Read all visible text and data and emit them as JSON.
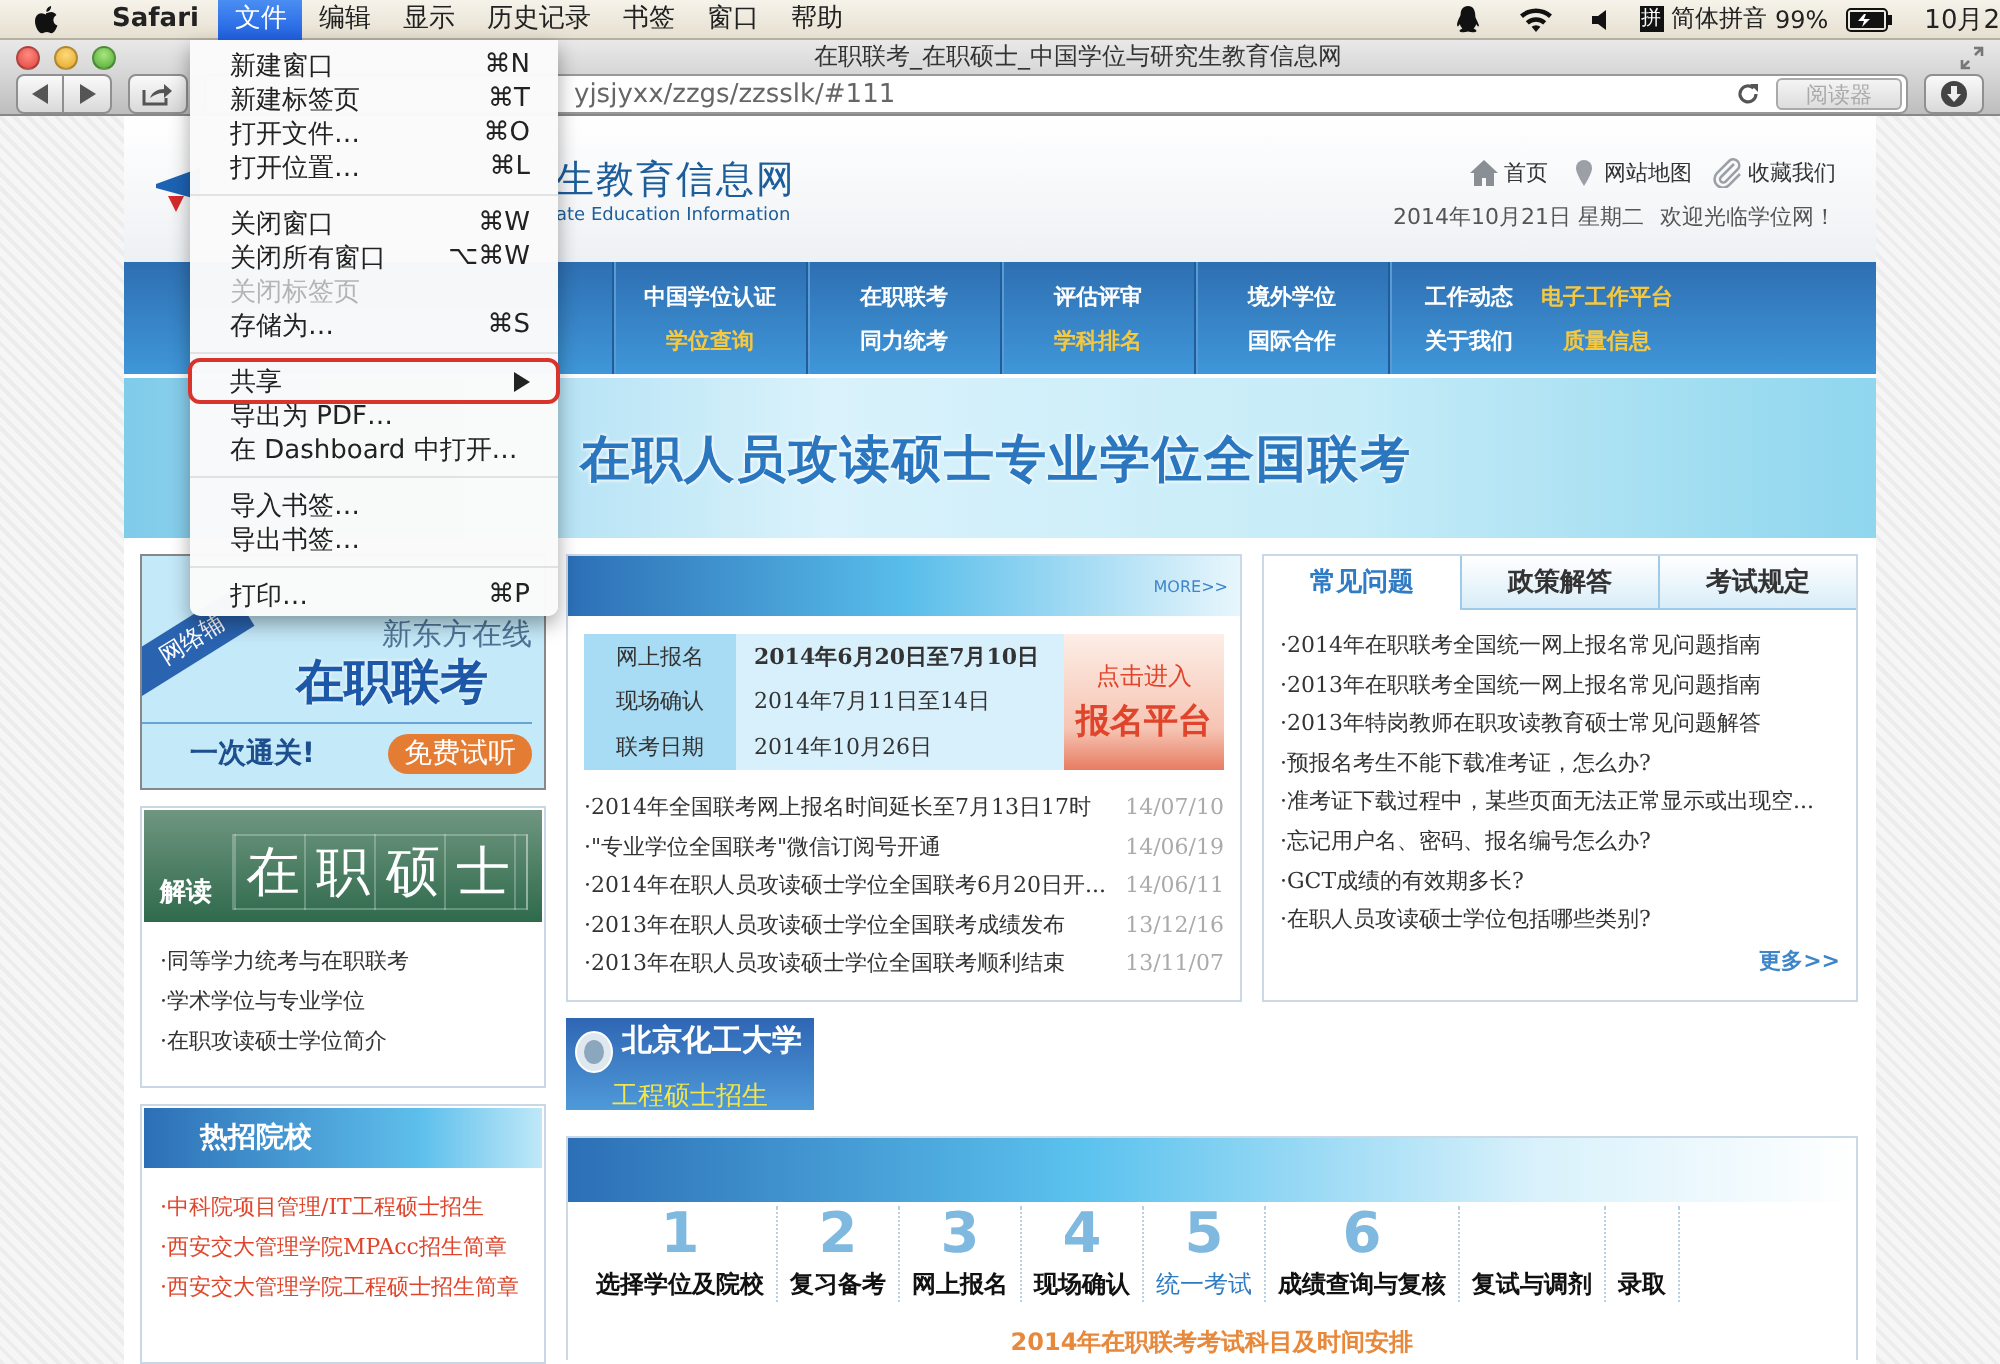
{
  "menubar": {
    "items": [
      {
        "label": "Safari",
        "kind": "app",
        "selected": false
      },
      {
        "label": "文件",
        "kind": "menu",
        "selected": true
      },
      {
        "label": "编辑",
        "kind": "menu",
        "selected": false
      },
      {
        "label": "显示",
        "kind": "menu",
        "selected": false
      },
      {
        "label": "历史记录",
        "kind": "menu",
        "selected": false
      },
      {
        "label": "书签",
        "kind": "menu",
        "selected": false
      },
      {
        "label": "窗口",
        "kind": "menu",
        "selected": false
      },
      {
        "label": "帮助",
        "kind": "menu",
        "selected": false
      }
    ],
    "input_icon": "拼",
    "input_method": "简体拼音",
    "battery": "99%",
    "clock": "10月2"
  },
  "file_menu": {
    "items": [
      {
        "kind": "item",
        "label": "新建窗口",
        "shortcut": "⌘N",
        "disabled": false,
        "submenu": false,
        "marked": false
      },
      {
        "kind": "item",
        "label": "新建标签页",
        "shortcut": "⌘T",
        "disabled": false,
        "submenu": false,
        "marked": false
      },
      {
        "kind": "item",
        "label": "打开文件…",
        "shortcut": "⌘O",
        "disabled": false,
        "submenu": false,
        "marked": false
      },
      {
        "kind": "item",
        "label": "打开位置…",
        "shortcut": "⌘L",
        "disabled": false,
        "submenu": false,
        "marked": false
      },
      {
        "kind": "separator"
      },
      {
        "kind": "item",
        "label": "关闭窗口",
        "shortcut": "⌘W",
        "disabled": false,
        "submenu": false,
        "marked": false
      },
      {
        "kind": "item",
        "label": "关闭所有窗口",
        "shortcut": "⌥⌘W",
        "disabled": false,
        "submenu": false,
        "marked": false
      },
      {
        "kind": "item",
        "label": "关闭标签页",
        "disabled": true,
        "submenu": false,
        "marked": false
      },
      {
        "kind": "item",
        "label": "存储为…",
        "shortcut": "⌘S",
        "disabled": false,
        "submenu": false,
        "marked": false
      },
      {
        "kind": "separator"
      },
      {
        "kind": "item",
        "label": "共享",
        "disabled": false,
        "submenu": true,
        "marked": true
      },
      {
        "kind": "item",
        "label": "导出为 PDF…",
        "disabled": false,
        "submenu": false,
        "marked": false
      },
      {
        "kind": "item",
        "label": "在 Dashboard 中打开…",
        "disabled": false,
        "submenu": false,
        "marked": false
      },
      {
        "kind": "separator"
      },
      {
        "kind": "item",
        "label": "导入书签…",
        "disabled": false,
        "submenu": false,
        "marked": false
      },
      {
        "kind": "item",
        "label": "导出书签…",
        "disabled": false,
        "submenu": false,
        "marked": false
      },
      {
        "kind": "separator"
      },
      {
        "kind": "item",
        "label": "打印…",
        "shortcut": "⌘P",
        "disabled": false,
        "submenu": false,
        "marked": false
      }
    ]
  },
  "window": {
    "title": "在职联考_在职硕士_中国学位与研究生教育信息网",
    "address": "yjsjyxx/zzgs/zzsslk/#111",
    "reader_button": {
      "label": "阅读器",
      "disabled": true
    }
  },
  "site": {
    "logo": {
      "title": "生教育信息网",
      "subtitle": "ate Education Information"
    },
    "top_links": [
      {
        "label": "首页",
        "kind": "home"
      },
      {
        "label": "网站地图",
        "kind": "pin"
      },
      {
        "label": "收藏我们",
        "kind": "clip"
      }
    ],
    "date": "2014年10月21日 星期二",
    "welcome": "欢迎光临学位网！",
    "nav": [
      {
        "links": [
          {
            "label": "中国学位认证",
            "highlight": false
          },
          {
            "label": "学位查询",
            "highlight": true
          }
        ]
      },
      {
        "links": [
          {
            "label": "在职联考",
            "highlight": false
          },
          {
            "label": "同力统考",
            "highlight": false
          }
        ]
      },
      {
        "links": [
          {
            "label": "评估评审",
            "highlight": false
          },
          {
            "label": "学科排名",
            "highlight": true
          }
        ]
      },
      {
        "links": [
          {
            "label": "境外学位",
            "highlight": false
          },
          {
            "label": "国际合作",
            "highlight": false
          }
        ]
      },
      {
        "links": [
          {
            "label": "工作动态",
            "highlight": false
          },
          {
            "label": "关于我们",
            "highlight": false
          },
          {
            "label": "电子工作平台",
            "highlight": true
          },
          {
            "label": "质量信息",
            "highlight": true
          }
        ]
      }
    ],
    "banner": {
      "title": "在职人员攻读硕士专业学位全国联考"
    },
    "left_ad": {
      "ribbon": "网络辅",
      "brand": "新东方在线",
      "title": "在职联考",
      "slogan": "一次通关!",
      "button": "免费试听"
    },
    "interpret": {
      "prefix": "解读",
      "title": "在职硕士",
      "links": [
        "·同等学力统考与在职联考",
        "·学术学位与专业学位",
        "·在职攻读硕士学位简介"
      ]
    },
    "hot_schools": {
      "title": "热招院校",
      "links": [
        "·中科院项目管理/IT工程硕士招生",
        "·西安交大管理学院MPAcc招生简章",
        "·西安交大管理学院工程硕士招生简章"
      ]
    },
    "exam": {
      "more": "MORE>>",
      "schedule": [
        {
          "label": "网上报名",
          "value": "2014年6月20日至7月10日",
          "bold": true
        },
        {
          "label": "现场确认",
          "value": "2014年7月11日至14日",
          "bold": false
        },
        {
          "label": "联考日期",
          "value": "2014年10月26日",
          "bold": false
        }
      ],
      "enter_button": {
        "line1": "点击进入",
        "line2": "报名平台"
      },
      "news": [
        {
          "title": "·2014年全国联考网上报名时间延长至7月13日17时",
          "date": "14/07/10"
        },
        {
          "title": "·\"专业学位全国联考\"微信订阅号开通",
          "date": "14/06/19"
        },
        {
          "title": "·2014年在职人员攻读硕士学位全国联考6月20日开...",
          "date": "14/06/11"
        },
        {
          "title": "·2013年在职人员攻读硕士学位全国联考成绩发布",
          "date": "13/12/16"
        },
        {
          "title": "·2013年在职人员攻读硕士学位全国联考顺利结束",
          "date": "13/11/07"
        }
      ]
    },
    "school_ad": {
      "name": "北京化工大学",
      "subtitle": "工程硕士招生"
    },
    "faq": {
      "tabs": [
        {
          "label": "常见问题",
          "selected": true
        },
        {
          "label": "政策解答",
          "selected": false
        },
        {
          "label": "考试规定",
          "selected": false
        }
      ],
      "items": [
        "·2014年在职联考全国统一网上报名常见问题指南",
        "·2013年在职联考全国统一网上报名常见问题指南",
        "·2013年特岗教师在职攻读教育硕士常见问题解答",
        "·预报名考生不能下载准考证，怎么办?",
        "·准考证下载过程中，某些页面无法正常显示或出现空...",
        "·忘记用户名、密码、报名编号怎么办?",
        "·GCT成绩的有效期多长?",
        "·在职人员攻读硕士学位包括哪些类别?"
      ],
      "more": "更多>>"
    },
    "steps": {
      "items": [
        {
          "number": "1",
          "label": "选择学位及院校",
          "selected": false
        },
        {
          "number": "2",
          "label": "复习备考",
          "selected": false
        },
        {
          "number": "3",
          "label": "网上报名",
          "selected": false
        },
        {
          "number": "4",
          "label": "现场确认",
          "selected": false
        },
        {
          "number": "5",
          "label": "统一考试",
          "selected": true
        },
        {
          "number": "6",
          "label": "成绩查询与复核",
          "selected": false
        },
        {
          "label": "复试与调剂",
          "selected": false
        },
        {
          "label": "录取",
          "selected": false
        }
      ],
      "heading": "2014年在职联考考试科目及时间安排"
    }
  }
}
